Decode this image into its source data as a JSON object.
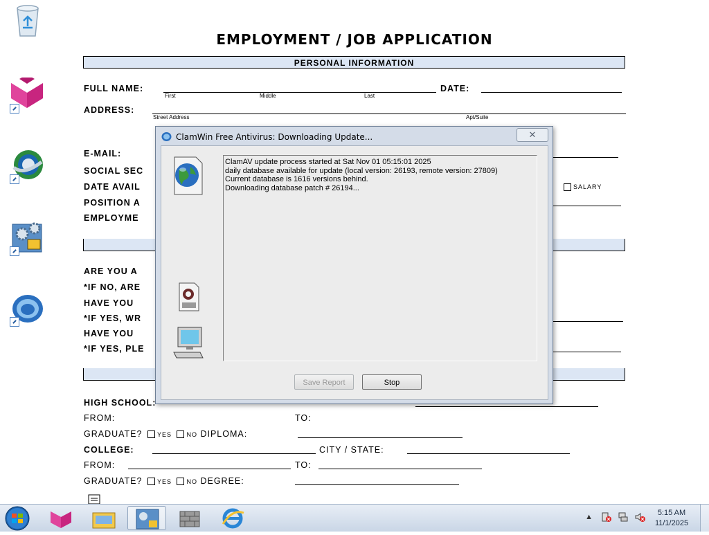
{
  "desktop": {
    "icons": [
      "recycle-bin-icon",
      "app-shortcut-magenta-icon",
      "browser-shortcut-icon",
      "settings-shortcut-icon",
      "clamwin-shortcut-icon"
    ]
  },
  "document": {
    "title": "EMPLOYMENT / JOB APPLICATION",
    "section_personal": "PERSONAL INFORMATION",
    "full_name_label": "FULL NAME:",
    "name_sub_first": "First",
    "name_sub_middle": "Middle",
    "name_sub_last": "Last",
    "date_label": "DATE:",
    "address_label": "ADDRESS:",
    "addr_sub_street": "Street Address",
    "addr_sub_apt": "Apt/Suite",
    "email_label": "E-MAIL:",
    "ssn_label": "SOCIAL SEC",
    "date_avail_label": "DATE AVAIL",
    "salary_label": "SALARY",
    "position_label": "POSITION A",
    "employment_label": "EMPLOYME",
    "are_you_label": "ARE YOU A",
    "if_no_label": "*IF NO, ARE",
    "have_you_1": "HAVE YOU",
    "if_yes_wr": "*IF YES, WR",
    "have_you_2": "HAVE YOU",
    "if_yes_ple": "*IF YES, PLE",
    "high_school_label": "HIGH SCHOOL:",
    "from_label_1": "FROM:",
    "to_label_1": "TO:",
    "graduate_label_1": "GRADUATE?",
    "yes_1": "YES",
    "no_1": "NO",
    "diploma_label": "DIPLOMA:",
    "college_label": "COLLEGE:",
    "city_state_label": "CITY / STATE:",
    "from_label_2": "FROM:",
    "to_label_2": "TO:",
    "graduate_label_2": "GRADUATE?",
    "yes_2": "YES",
    "no_2": "NO",
    "degree_label": "DEGREE:"
  },
  "dialog": {
    "title": "ClamWin Free Antivirus: Downloading Update...",
    "close_glyph": "✕",
    "log_lines": [
      "ClamAV update process started at Sat Nov 01 05:15:01 2025",
      "daily database available for update (local version: 26193, remote version: 27809)",
      "Current database is 1616 versions behind.",
      "Downloading database patch # 26194..."
    ],
    "save_report_label": "Save Report",
    "stop_label": "Stop"
  },
  "taskbar": {
    "clock_time": "5:15 AM",
    "clock_date": "11/1/2025",
    "tray_arrow": "▲"
  }
}
